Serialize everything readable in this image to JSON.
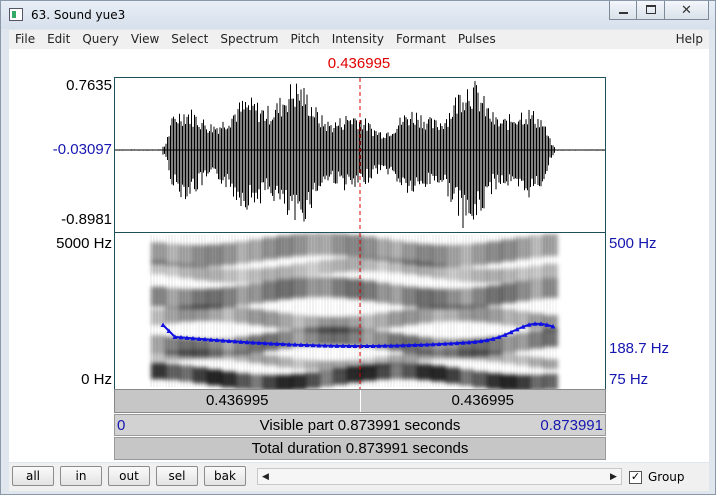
{
  "window": {
    "title": "63. Sound yue3",
    "minimize_label": "",
    "maximize_label": "",
    "close_label": "✕"
  },
  "menu": [
    "File",
    "Edit",
    "Query",
    "View",
    "Select",
    "Spectrum",
    "Pitch",
    "Intensity",
    "Formant",
    "Pulses"
  ],
  "menu_help": "Help",
  "cursor_time": "0.436995",
  "cursor_fraction": 0.5,
  "waveform": {
    "max_label": "0.7635",
    "cursor_value_label": "-0.03097",
    "min_label": "-0.8981"
  },
  "spectrogram": {
    "top_freq_label": "5000 Hz",
    "bottom_freq_label": "0 Hz",
    "pitch_top_label": "500 Hz",
    "pitch_current_label": "188.7 Hz",
    "pitch_bottom_label": "75 Hz",
    "colors": {
      "pitch": "#1010e0",
      "cursor": "#e00000"
    }
  },
  "time_bar": {
    "left_label": "0.436995",
    "right_label": "0.436995"
  },
  "visible_bar": {
    "start_label": "0",
    "text": "Visible part 0.873991 seconds",
    "end_label": "0.873991"
  },
  "total_bar": {
    "text": "Total duration 0.873991 seconds"
  },
  "buttons": {
    "all": "all",
    "in": "in",
    "out": "out",
    "sel": "sel",
    "bak": "bak"
  },
  "group": {
    "label": "Group",
    "checked": true,
    "check_glyph": "✓"
  },
  "scroll": {
    "left_arrow": "◀",
    "right_arrow": "▶"
  }
}
